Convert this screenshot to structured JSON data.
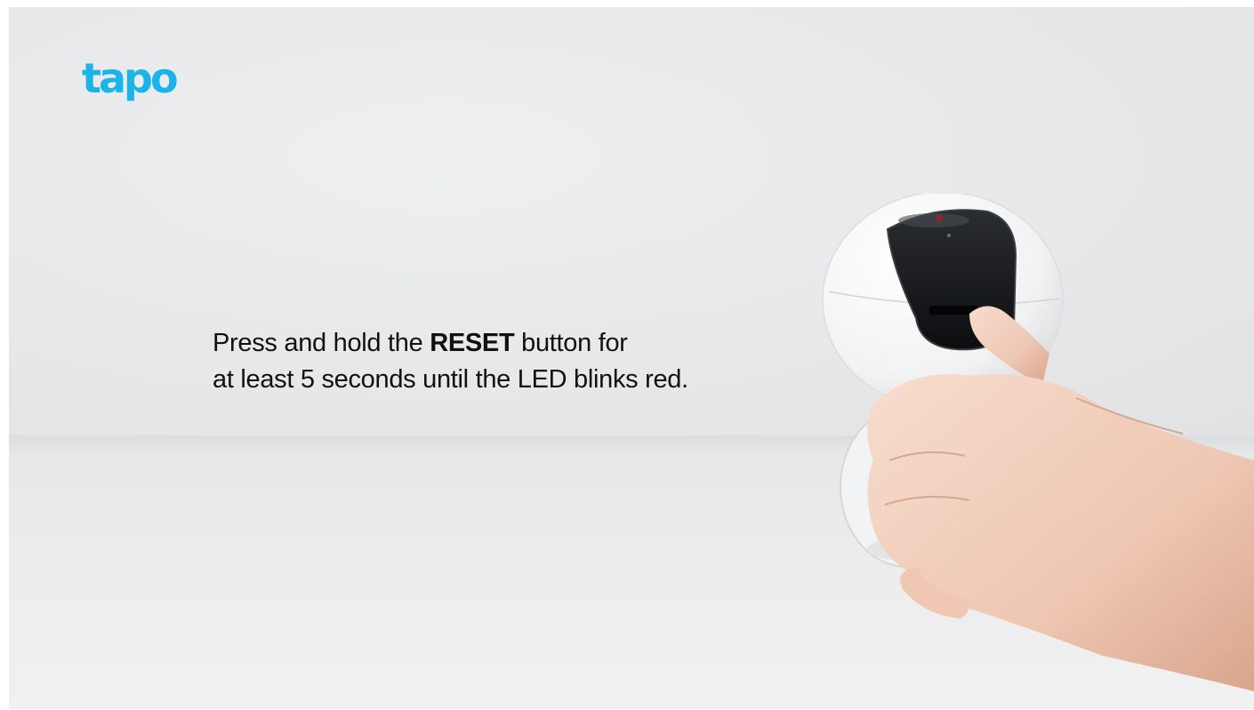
{
  "brand": {
    "logo_text": "tapo",
    "logo_color": "#1ab4e8"
  },
  "caption": {
    "line1_prefix": "Press and hold the ",
    "line1_bold": "RESET",
    "line1_suffix": " button for",
    "line2": "at least 5 seconds until the LED blinks red."
  },
  "colors": {
    "wall": "#e7e8ea",
    "table": "#ececed",
    "text": "#111111"
  }
}
